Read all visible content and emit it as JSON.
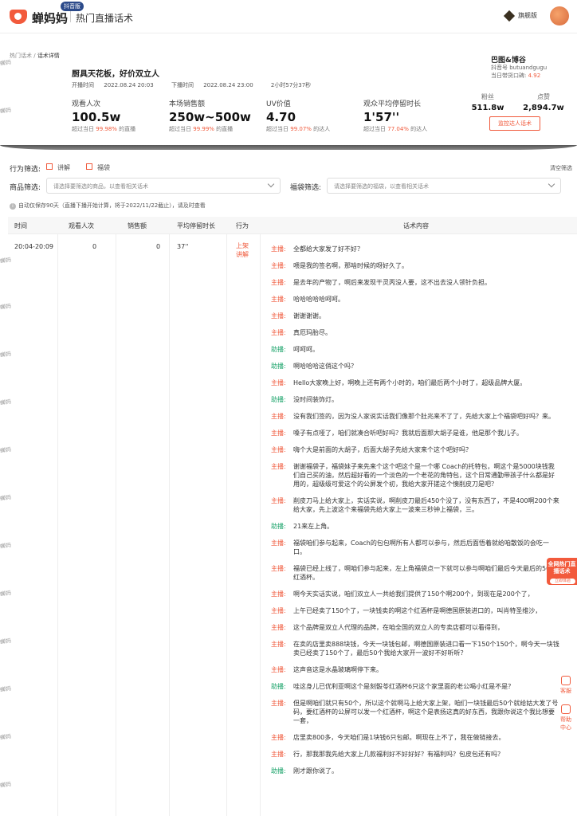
{
  "topbar": {
    "brand": "蝉妈妈",
    "badge": "抖音版",
    "section": "热门直播话术",
    "vip_label": "旗舰版",
    "vip_icon": "diamond-icon",
    "avatar_icon": "avatar-icon"
  },
  "breadcrumb": {
    "parent": "热门话术",
    "sep": " / ",
    "current": "话术详情"
  },
  "watermark": "蝉妈",
  "live": {
    "title": "厨具天花板，好价双立人",
    "start_label": "开播时间",
    "start": "2022.08.24 20:03",
    "end_label": "下播时间",
    "end": "2022.08.24 23:00",
    "duration": "2小时57分37秒"
  },
  "stats": [
    {
      "label": "观看人次",
      "value": "100.5w",
      "sub_pre": "超过当日",
      "pct": "99.98%",
      "sub_post": "的直播"
    },
    {
      "label": "本场销售额",
      "value": "250w~500w",
      "sub_pre": "超过当日",
      "pct": "99.99%",
      "sub_post": "的直播"
    },
    {
      "label": "UV价值",
      "value": "4.70",
      "sub_pre": "超过当日",
      "pct": "99.07%",
      "sub_post": "的达人"
    },
    {
      "label": "观众平均停留时长",
      "value": "1'57''",
      "sub_pre": "超过当日",
      "pct": "77.04%",
      "sub_post": "的达人"
    }
  ],
  "account": {
    "name": "巴图&博谷",
    "id_label": "抖音号",
    "id": "butuandgugu",
    "rate_label": "当日带货口碑:",
    "rate": "4.92",
    "fans_label": "粉丝",
    "fans": "511.8w",
    "likes_label": "点赞",
    "likes": "2,894.7w",
    "monitor_button": "监控达人话术"
  },
  "filters": {
    "behavior_label": "行为筛选:",
    "opt1": "讲解",
    "opt2": "福袋",
    "clear": "清空筛选",
    "product_label": "商品筛选:",
    "product_placeholder": "请选择要筛选的商品，以查看相关话术",
    "bag_label": "福袋筛选:",
    "bag_placeholder": "请选择要筛选的福袋，以查看相关话术",
    "notice": "自动仅保存90天（直播下播开始计算，将于2022/11/22截止），请及时查看"
  },
  "table": {
    "headers": [
      "时间",
      "观看人次",
      "销售额",
      "平均停留时长",
      "行为",
      "话术内容"
    ],
    "row": {
      "time": "20:04-20:09",
      "views": "0",
      "sales": "0",
      "stay": "37''",
      "action1": "上架",
      "action2": "讲解"
    },
    "lines": [
      {
        "role": "主播:",
        "type": "host",
        "text": "全都给大家发了好不好？"
      },
      {
        "role": "主播:",
        "type": "host",
        "text": "喂是我的签名啊，那啥时候的呀好久了。"
      },
      {
        "role": "主播:",
        "type": "host",
        "text": "是去年的产物了，啊后来发现干灵丙没人要，这不出去没人领针负担。"
      },
      {
        "role": "主播:",
        "type": "host",
        "text": "哈哈哈哈哈呵呵。"
      },
      {
        "role": "主播:",
        "type": "host",
        "text": "谢谢谢谢。"
      },
      {
        "role": "主播:",
        "type": "host",
        "text": "真厄玛胎尽。"
      },
      {
        "role": "助播:",
        "type": "assist",
        "text": "呵呵呵。"
      },
      {
        "role": "助播:",
        "type": "assist",
        "text": "啊哈哈哈这俏这个吗？"
      },
      {
        "role": "主播:",
        "type": "host",
        "text": "Hello大家晚上好，啊晚上还有两个小时的，咱们最后两个小时了，超级品牌大厦。"
      },
      {
        "role": "助播:",
        "type": "assist",
        "text": "没时间装饰灯。"
      },
      {
        "role": "主播:",
        "type": "host",
        "text": "没有我们签的，因为没人家说实话我们像那个肚兆来不了了，先给大家上个福袋吧好吗？来。"
      },
      {
        "role": "主播:",
        "type": "host",
        "text": "嗓子有点哑了，咱们就凑合听吧好吗？我就后面那大胡子是谁，他是那个我儿子。"
      },
      {
        "role": "主播:",
        "type": "host",
        "text": "嗨个大是前面的大胡子，后面大胡子先给大家来个这个吧好吗？"
      },
      {
        "role": "主播:",
        "type": "host",
        "text": "谢谢福袋子，福袋妹子来先来个这个吧这个是一个哪 Coach的托特包，啊这个是5000块钱我们自己买的油，然后超好看的一个淡色的一个老花的角特包，这个日常通勤带孩子什么都是好用的，超级级可爱这个的公屏发个初，我给大家开搓这个懊削皮刀是吧？"
      },
      {
        "role": "主播:",
        "type": "host",
        "text": "削皮刀马上给大家上，实话实说，啊削皮刀最后450个没了，没有东西了，不是400啊200个来给大家，先上波这个来福袋先给大家上一波来三秒钟上福袋，三。"
      },
      {
        "role": "助播:",
        "type": "assist",
        "text": "21来左上角。"
      },
      {
        "role": "主播:",
        "type": "host",
        "text": "福袋咱们参与起来，Coach的包包啊所有人都可以参与，然后后面悟着就给咱散饭的会吃一口。"
      },
      {
        "role": "主播:",
        "type": "host",
        "text": "福袋已经上线了，啊咱们参与起来，左上角福袋点一下就可以参与啊咱们最后今天最后的50个红酒杯。"
      },
      {
        "role": "主播:",
        "type": "host",
        "text": "啊今天实话实说，咱们双立人一共给我们提供了150个啊200个，到现在是200个了，"
      },
      {
        "role": "主播:",
        "type": "host",
        "text": "上午已经卖了150个了，一块钱卖的啊这个红酒杯是啊德国原装进口的，叫肖特圣维沙，"
      },
      {
        "role": "主播:",
        "type": "host",
        "text": "这个品牌是双立人代理的品牌，在咱全国的双立人的专卖店都可以看得到，"
      },
      {
        "role": "主播:",
        "type": "host",
        "text": "在卖的店里卖888块钱，今天一块钱包邮，啊德国原装进口看一下150个150个，啊今天一块钱卖已经卖了150个了，最后50个我给大家开一波好不好听听？"
      },
      {
        "role": "主播:",
        "type": "host",
        "text": "这声音这是水晶玻璃啊停下来。"
      },
      {
        "role": "助播:",
        "type": "assist",
        "text": "哇这身儿已优利亚啊这个是刻骰苓红酒杯6只这个家里面的老公喝小红是不是？"
      },
      {
        "role": "主播:",
        "type": "host",
        "text": "但是啊咱们就只有50个，所以这个就啊马上给大家上架，咱们一块钱最后50个就给姑大发了号码，要红酒杯的公屏可以发一个红酒杯，啊这个是表扬这真的好东西，我跟你说这个我比想要一套，"
      },
      {
        "role": "主播:",
        "type": "host",
        "text": "店里卖800多，今天咱们是1块钱6只包邮。啊现在上不了，我在做链接去。"
      },
      {
        "role": "主播:",
        "type": "host",
        "text": "行，那我那我先给大家上几款福利好不好好好？有福利吗？包皮包还有吗？"
      },
      {
        "role": "助播:",
        "type": "assist",
        "text": "刚才跟你说了。"
      }
    ]
  },
  "side": {
    "promo": "全网热门直播话术",
    "promo_sub": "立即体验",
    "service_label": "客服",
    "help_label": "帮助中心"
  },
  "colors": {
    "accent": "#f05a3c",
    "assist": "#1aa36a"
  }
}
